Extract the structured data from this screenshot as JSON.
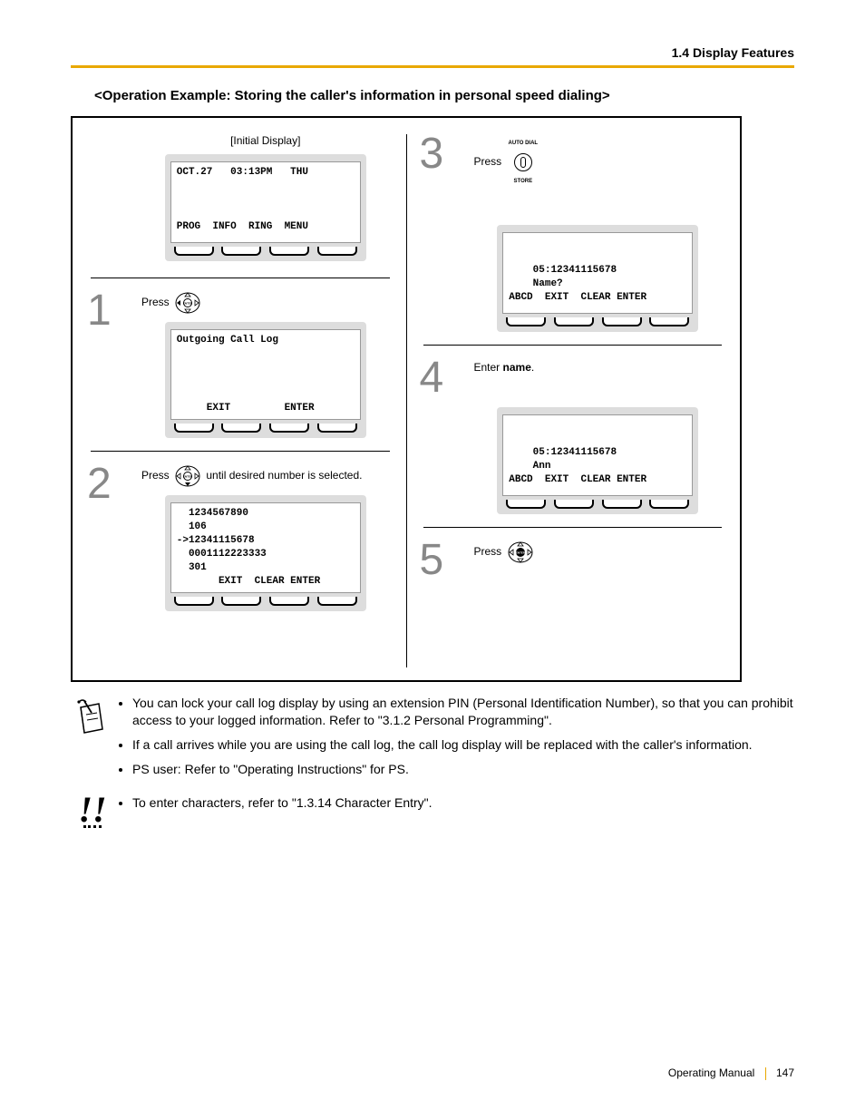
{
  "header": {
    "section": "1.4 Display Features"
  },
  "title": "<Operation Example: Storing the caller's information in personal speed dialing>",
  "initial": {
    "label": "[Initial Display]",
    "line1": "OCT.27   03:13PM   THU",
    "soft": "PROG  INFO  RING  MENU"
  },
  "step1": {
    "num": "1",
    "press": "Press",
    "lcd_line1": "Outgoing Call Log",
    "soft": "     EXIT         ENTER"
  },
  "step2": {
    "num": "2",
    "press": "Press",
    "after": " until desired number is selected.",
    "lcd": "  1234567890\n  106\n->12341115678\n  0001112223333\n  301",
    "soft": "       EXIT  CLEAR ENTER"
  },
  "step3": {
    "num": "3",
    "press": "Press",
    "autodial_top": "AUTO DIAL",
    "autodial_bot": "STORE",
    "lcd": "\n\n    05:12341115678\n    Name?",
    "soft": "ABCD  EXIT  CLEAR ENTER"
  },
  "step4": {
    "num": "4",
    "press": "Enter ",
    "bold": "name",
    "dot": ".",
    "lcd": "\n\n    05:12341115678\n    Ann",
    "soft": "ABCD  EXIT  CLEAR ENTER"
  },
  "step5": {
    "num": "5",
    "press": "Press"
  },
  "notes1": [
    "You can lock your call log display by using an extension PIN (Personal Identification Number), so that you can prohibit access to your logged information. Refer to \"3.1.2 Personal Programming\".",
    "If a call arrives while you are using the call log, the call log display will be replaced with the caller's information.",
    "PS user: Refer to \"Operating Instructions\" for PS."
  ],
  "notes2": [
    "To enter characters, refer to \"1.3.14 Character Entry\"."
  ],
  "footer": {
    "label": "Operating Manual",
    "page": "147"
  }
}
